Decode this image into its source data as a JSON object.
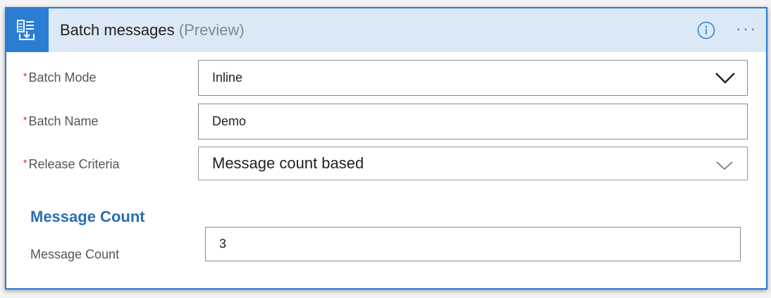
{
  "header": {
    "title": "Batch messages",
    "title_suffix": "(Preview)",
    "icon": "batch-messages-icon",
    "info_icon": "info-icon",
    "more_label": "···"
  },
  "form": {
    "required_marker": "*",
    "batch_mode": {
      "label": "Batch Mode",
      "value": "Inline"
    },
    "batch_name": {
      "label": "Batch Name",
      "value": "Demo"
    },
    "release_criteria": {
      "label": "Release Criteria",
      "value": "Message count based"
    }
  },
  "message_count_section": {
    "title": "Message Count",
    "label": "Message Count",
    "value": "3"
  },
  "colors": {
    "accent": "#2b7cd3",
    "header_bg": "#dbe8f5",
    "required": "#c4262e",
    "section_title": "#2b6cb3"
  }
}
